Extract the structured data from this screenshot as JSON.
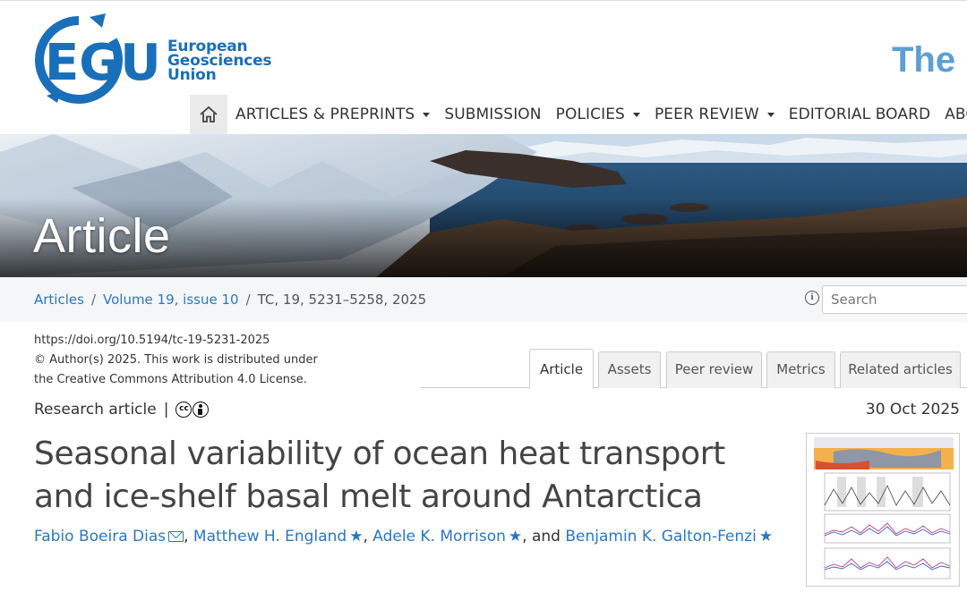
{
  "brand": {
    "logo_letters": "EGU",
    "org_line1": "European",
    "org_line2": "Geosciences",
    "org_line3": "Union",
    "journal_title_fragment": "The C",
    "color_primary": "#1a6fba"
  },
  "nav": {
    "home_icon": "home-icon",
    "items": [
      {
        "label": "ARTICLES & PREPRINTS",
        "dropdown": true
      },
      {
        "label": "SUBMISSION",
        "dropdown": false
      },
      {
        "label": "POLICIES",
        "dropdown": true
      },
      {
        "label": "PEER REVIEW",
        "dropdown": true
      },
      {
        "label": "EDITORIAL BOARD",
        "dropdown": false
      },
      {
        "label": "ABOUT",
        "dropdown": true
      }
    ]
  },
  "banner": {
    "title": "Article"
  },
  "breadcrumb": {
    "articles": "Articles",
    "volume": "Volume 19, issue 10",
    "current": "TC, 19, 5231–5258, 2025",
    "sep": "/"
  },
  "search": {
    "placeholder": "Search"
  },
  "meta": {
    "doi": "https://doi.org/10.5194/tc-19-5231-2025",
    "copyright": "© Author(s) 2025. This work is distributed under",
    "license": "the Creative Commons Attribution 4.0 License."
  },
  "tabs": [
    {
      "label": "Article",
      "active": true
    },
    {
      "label": "Assets",
      "active": false
    },
    {
      "label": "Peer review",
      "active": false
    },
    {
      "label": "Metrics",
      "active": false
    },
    {
      "label": "Related articles",
      "active": false
    }
  ],
  "article": {
    "type": "Research article",
    "bar": "|",
    "date": "30 Oct 2025",
    "title": "Seasonal variability of ocean heat transport and ice-shelf basal melt around Antarctica",
    "authors": [
      {
        "name": "Fabio Boeira Dias",
        "marker": "mail-icon"
      },
      {
        "name": "Matthew H. England",
        "marker": "star-icon"
      },
      {
        "name": "Adele K. Morrison",
        "marker": "star-icon"
      },
      {
        "name": "Benjamin K. Galton-Fenzi",
        "marker": "star-icon"
      }
    ],
    "authors_and": "and"
  }
}
